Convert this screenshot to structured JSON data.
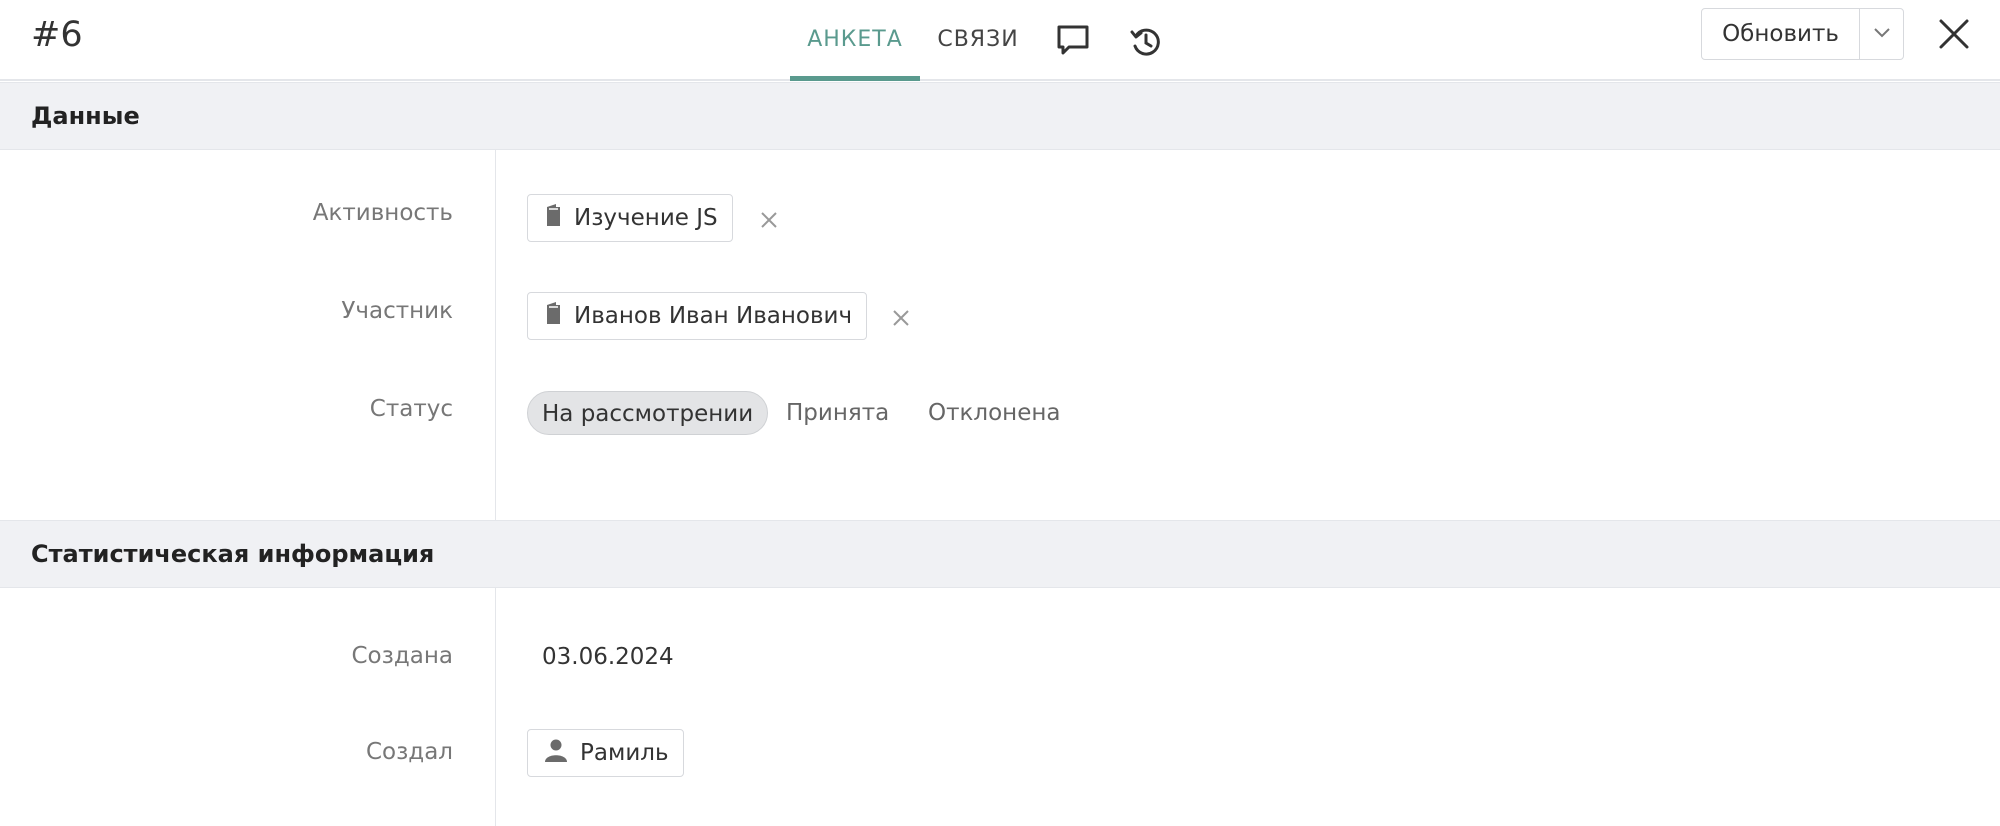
{
  "header": {
    "record_id": "#6",
    "tabs": [
      {
        "label": "АНКЕТА",
        "active": true
      },
      {
        "label": "СВЯЗИ",
        "active": false
      }
    ],
    "icons": [
      "comment-icon",
      "history-icon"
    ],
    "update_button": "Обновить",
    "accent_color": "#5a9a8e"
  },
  "sections": {
    "data": {
      "title": "Данные",
      "activity": {
        "label": "Активность",
        "value": "Изучение JS"
      },
      "participant": {
        "label": "Участник",
        "value": "Иванов Иван Иванович"
      },
      "status": {
        "label": "Статус",
        "options": [
          "На рассмотрении",
          "Принята",
          "Отклонена"
        ],
        "selected": "На рассмотрении"
      }
    },
    "stats": {
      "title": "Статистическая информация",
      "created": {
        "label": "Создана",
        "value": "03.06.2024"
      },
      "created_by": {
        "label": "Создал",
        "value": "Рамиль"
      }
    }
  }
}
